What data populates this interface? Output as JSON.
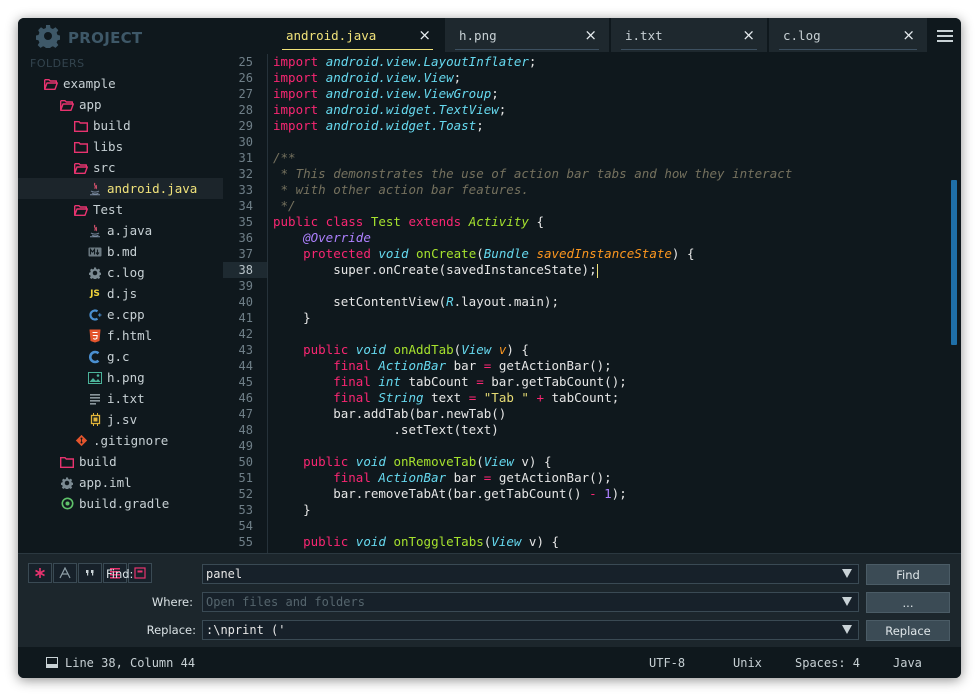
{
  "sidebar": {
    "project_title": "PROJECT",
    "folders_label": "FOLDERS",
    "tree": [
      {
        "label": "example",
        "icon": "folder-open",
        "depth": 1
      },
      {
        "label": "app",
        "icon": "folder-open",
        "depth": 2
      },
      {
        "label": "build",
        "icon": "folder",
        "depth": 3
      },
      {
        "label": "libs",
        "icon": "folder",
        "depth": 3
      },
      {
        "label": "src",
        "icon": "folder-open",
        "depth": 3
      },
      {
        "label": "android.java",
        "icon": "java",
        "depth": 4,
        "selected": true
      },
      {
        "label": "Test",
        "icon": "folder-open",
        "depth": 3
      },
      {
        "label": "a.java",
        "icon": "java",
        "depth": 4
      },
      {
        "label": "b.md",
        "icon": "markdown",
        "depth": 4
      },
      {
        "label": "c.log",
        "icon": "gear",
        "depth": 4
      },
      {
        "label": "d.js",
        "icon": "js",
        "depth": 4
      },
      {
        "label": "e.cpp",
        "icon": "cpp",
        "depth": 4
      },
      {
        "label": "f.html",
        "icon": "html",
        "depth": 4
      },
      {
        "label": "g.c",
        "icon": "c",
        "depth": 4
      },
      {
        "label": "h.png",
        "icon": "image",
        "depth": 4
      },
      {
        "label": "i.txt",
        "icon": "text",
        "depth": 4
      },
      {
        "label": "j.sv",
        "icon": "chip",
        "depth": 4
      },
      {
        "label": ".gitignore",
        "icon": "git",
        "depth": 3
      },
      {
        "label": "build",
        "icon": "folder",
        "depth": 2
      },
      {
        "label": "app.iml",
        "icon": "gear",
        "depth": 2
      },
      {
        "label": "build.gradle",
        "icon": "gradle",
        "depth": 2
      }
    ]
  },
  "tabs": [
    {
      "label": "android.java",
      "active": true
    },
    {
      "label": "h.png",
      "active": false
    },
    {
      "label": "i.txt",
      "active": false
    },
    {
      "label": "c.log",
      "active": false
    }
  ],
  "tab_close_glyph": "×",
  "editor": {
    "current_line": 38,
    "lines": [
      {
        "n": "25",
        "tokens": [
          [
            "kw",
            "import "
          ],
          [
            "pk",
            "android.view.LayoutInflater"
          ],
          [
            "pl",
            ";"
          ]
        ]
      },
      {
        "n": "26",
        "tokens": [
          [
            "kw",
            "import "
          ],
          [
            "pk",
            "android.view.View"
          ],
          [
            "pl",
            ";"
          ]
        ]
      },
      {
        "n": "27",
        "tokens": [
          [
            "kw",
            "import "
          ],
          [
            "pk",
            "android.view.ViewGroup"
          ],
          [
            "pl",
            ";"
          ]
        ]
      },
      {
        "n": "28",
        "tokens": [
          [
            "kw",
            "import "
          ],
          [
            "pk",
            "android.widget.TextView"
          ],
          [
            "pl",
            ";"
          ]
        ]
      },
      {
        "n": "29",
        "tokens": [
          [
            "kw",
            "import "
          ],
          [
            "pk",
            "android.widget.Toast"
          ],
          [
            "pl",
            ";"
          ]
        ]
      },
      {
        "n": "30",
        "tokens": []
      },
      {
        "n": "31",
        "tokens": [
          [
            "cm",
            "/**"
          ]
        ]
      },
      {
        "n": "32",
        "tokens": [
          [
            "cm",
            " * This demonstrates the use of action bar tabs and how they interact"
          ]
        ]
      },
      {
        "n": "33",
        "tokens": [
          [
            "cm",
            " * with other action bar features."
          ]
        ]
      },
      {
        "n": "34",
        "tokens": [
          [
            "cm",
            " */"
          ]
        ]
      },
      {
        "n": "35",
        "tokens": [
          [
            "kw",
            "public class "
          ],
          [
            "fn",
            "Test "
          ],
          [
            "kw",
            "extends "
          ],
          [
            "cls",
            "Activity"
          ],
          [
            "pl",
            " {"
          ]
        ]
      },
      {
        "n": "36",
        "tokens": [
          [
            "pl",
            "    "
          ],
          [
            "ann",
            "@Override"
          ]
        ]
      },
      {
        "n": "37",
        "tokens": [
          [
            "pl",
            "    "
          ],
          [
            "kw",
            "protected "
          ],
          [
            "tp",
            "void "
          ],
          [
            "fn",
            "onCreate"
          ],
          [
            "pl",
            "("
          ],
          [
            "tp",
            "Bundle "
          ],
          [
            "par",
            "savedInstanceState"
          ],
          [
            "pl",
            ") {"
          ]
        ]
      },
      {
        "n": "38",
        "tokens": [
          [
            "pl",
            "        super.onCreate(savedInstanceState);"
          ]
        ]
      },
      {
        "n": "39",
        "tokens": []
      },
      {
        "n": "40",
        "tokens": [
          [
            "pl",
            "        setContentView("
          ],
          [
            "tp",
            "R"
          ],
          [
            "pl",
            ".layout.main);"
          ]
        ]
      },
      {
        "n": "41",
        "tokens": [
          [
            "pl",
            "    }"
          ]
        ]
      },
      {
        "n": "42",
        "tokens": []
      },
      {
        "n": "43",
        "tokens": [
          [
            "pl",
            "    "
          ],
          [
            "kw",
            "public "
          ],
          [
            "tp",
            "void "
          ],
          [
            "fn",
            "onAddTab"
          ],
          [
            "pl",
            "("
          ],
          [
            "tp",
            "View "
          ],
          [
            "par",
            "v"
          ],
          [
            "pl",
            ") {"
          ]
        ]
      },
      {
        "n": "44",
        "tokens": [
          [
            "pl",
            "        "
          ],
          [
            "kw",
            "final "
          ],
          [
            "tp",
            "ActionBar "
          ],
          [
            "pl",
            "bar "
          ],
          [
            "kw",
            "= "
          ],
          [
            "pl",
            "getActionBar();"
          ]
        ]
      },
      {
        "n": "45",
        "tokens": [
          [
            "pl",
            "        "
          ],
          [
            "kw",
            "final "
          ],
          [
            "tp",
            "int "
          ],
          [
            "pl",
            "tabCount "
          ],
          [
            "kw",
            "= "
          ],
          [
            "pl",
            "bar.getTabCount();"
          ]
        ]
      },
      {
        "n": "46",
        "tokens": [
          [
            "pl",
            "        "
          ],
          [
            "kw",
            "final "
          ],
          [
            "tp",
            "String "
          ],
          [
            "pl",
            "text "
          ],
          [
            "kw",
            "= "
          ],
          [
            "str",
            "\"Tab \""
          ],
          [
            "pl",
            " "
          ],
          [
            "kw",
            "+ "
          ],
          [
            "pl",
            "tabCount;"
          ]
        ]
      },
      {
        "n": "47",
        "tokens": [
          [
            "pl",
            "        bar.addTab(bar.newTab()"
          ]
        ]
      },
      {
        "n": "48",
        "tokens": [
          [
            "pl",
            "                .setText(text)"
          ]
        ]
      },
      {
        "n": "49",
        "tokens": []
      },
      {
        "n": "50",
        "tokens": [
          [
            "pl",
            "    "
          ],
          [
            "kw",
            "public "
          ],
          [
            "tp",
            "void "
          ],
          [
            "fn",
            "onRemoveTab"
          ],
          [
            "pl",
            "("
          ],
          [
            "tp",
            "View "
          ],
          [
            "pl",
            "v) {"
          ]
        ]
      },
      {
        "n": "51",
        "tokens": [
          [
            "pl",
            "        "
          ],
          [
            "kw",
            "final "
          ],
          [
            "tp",
            "ActionBar "
          ],
          [
            "pl",
            "bar "
          ],
          [
            "kw",
            "= "
          ],
          [
            "pl",
            "getActionBar();"
          ]
        ]
      },
      {
        "n": "52",
        "tokens": [
          [
            "pl",
            "        bar.removeTabAt(bar.getTabCount() "
          ],
          [
            "kw",
            "- "
          ],
          [
            "num",
            "1"
          ],
          [
            "pl",
            ");"
          ]
        ]
      },
      {
        "n": "53",
        "tokens": [
          [
            "pl",
            "    }"
          ]
        ]
      },
      {
        "n": "54",
        "tokens": []
      },
      {
        "n": "55",
        "tokens": [
          [
            "pl",
            "    "
          ],
          [
            "kw",
            "public "
          ],
          [
            "tp",
            "void "
          ],
          [
            "fn",
            "onToggleTabs"
          ],
          [
            "pl",
            "("
          ],
          [
            "tp",
            "View "
          ],
          [
            "pl",
            "v) {"
          ]
        ]
      }
    ]
  },
  "find": {
    "find_label": "Find:",
    "where_label": "Where:",
    "replace_label": "Replace:",
    "find_value": "panel",
    "where_placeholder": "Open files and folders",
    "replace_value": ":\\nprint ('",
    "find_button": "Find",
    "where_button": "...",
    "replace_button": "Replace"
  },
  "status": {
    "position": "Line 38, Column 44",
    "encoding": "UTF-8",
    "line_endings": "Unix",
    "indentation": "Spaces: 4",
    "syntax": "Java"
  },
  "colors": {
    "accent_yellow": "#f0e27a",
    "folder_pink": "#e8336f",
    "scrollbar_blue": "#1f6fa8"
  }
}
